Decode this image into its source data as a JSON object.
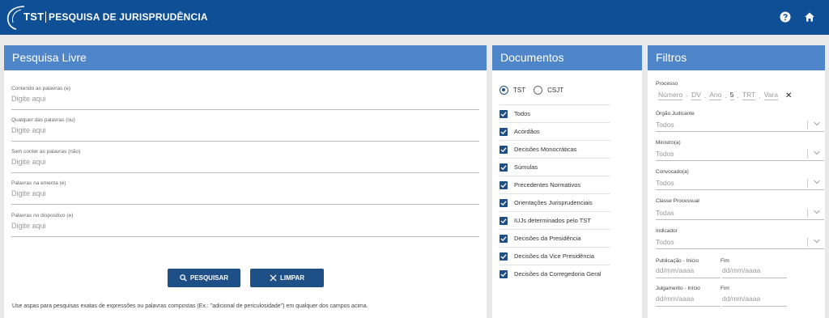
{
  "header": {
    "brand": "TST",
    "title": "PESQUISA DE JURISPRUDÊNCIA"
  },
  "pesquisa_livre": {
    "title": "Pesquisa Livre",
    "fields": [
      {
        "label": "Contendo as palavras (e)",
        "placeholder": "Digite aqui"
      },
      {
        "label": "Qualquer das palavras (ou)",
        "placeholder": "Digite aqui"
      },
      {
        "label": "Sem conter as palavras (não)",
        "placeholder": "Digite aqui"
      },
      {
        "label": "Palavras na ementa (e)",
        "placeholder": "Digite aqui"
      },
      {
        "label": "Palavras no dispositivo (e)",
        "placeholder": "Digite aqui"
      }
    ],
    "search_button": "PESQUISAR",
    "clear_button": "LIMPAR",
    "hint": "Use aspas para pesquisas exatas de expressões ou palavras compostas (Ex.: \"adicional de periculosidade\") em qualquer dos campos acima."
  },
  "documentos": {
    "title": "Documentos",
    "radio_options": [
      {
        "label": "TST",
        "selected": true
      },
      {
        "label": "CSJT",
        "selected": false
      }
    ],
    "items": [
      {
        "label": "Todos",
        "checked": true
      },
      {
        "label": "Acórdãos",
        "checked": true
      },
      {
        "label": "Decisões Monocráticas",
        "checked": true
      },
      {
        "label": "Súmulas",
        "checked": true
      },
      {
        "label": "Precedentes Normativos",
        "checked": true
      },
      {
        "label": "Orientações Jurisprudenciais",
        "checked": true
      },
      {
        "label": "IUJs determinados pelo TST",
        "checked": true
      },
      {
        "label": "Decisões da Presidência",
        "checked": true
      },
      {
        "label": "Decisões da Vice Presidência",
        "checked": true
      },
      {
        "label": "Decisões da Corregedoria Geral",
        "checked": true
      }
    ]
  },
  "filtros": {
    "title": "Filtros",
    "processo": {
      "label": "Processo",
      "numero": "Número",
      "dv": "DV",
      "ano": "Ano",
      "fixo": "5",
      "trt": "TRT",
      "vara": "Vara",
      "clear": "✕"
    },
    "selects": [
      {
        "label": "Órgão Judicante",
        "value": "Todos"
      },
      {
        "label": "Ministro(a)",
        "value": "Todos"
      },
      {
        "label": "Convocado(a)",
        "value": "Todos"
      },
      {
        "label": "Classe Processual",
        "value": "Todas"
      },
      {
        "label": "Indicador",
        "value": "Todos"
      }
    ],
    "publicacao": {
      "label_inicio": "Publicação - Início",
      "label_fim": "Fim",
      "placeholder": "dd/mm/aaaa"
    },
    "julgamento": {
      "label_inicio": "Julgamento - Início",
      "label_fim": "Fim",
      "placeholder": "dd/mm/aaaa"
    }
  },
  "colors": {
    "header": "#0f4f96",
    "panel_header": "#4f85c9",
    "button": "#1e4f87"
  },
  "icons": [
    "help-icon",
    "home-icon",
    "search-icon",
    "close-icon",
    "chevron-down-icon"
  ]
}
